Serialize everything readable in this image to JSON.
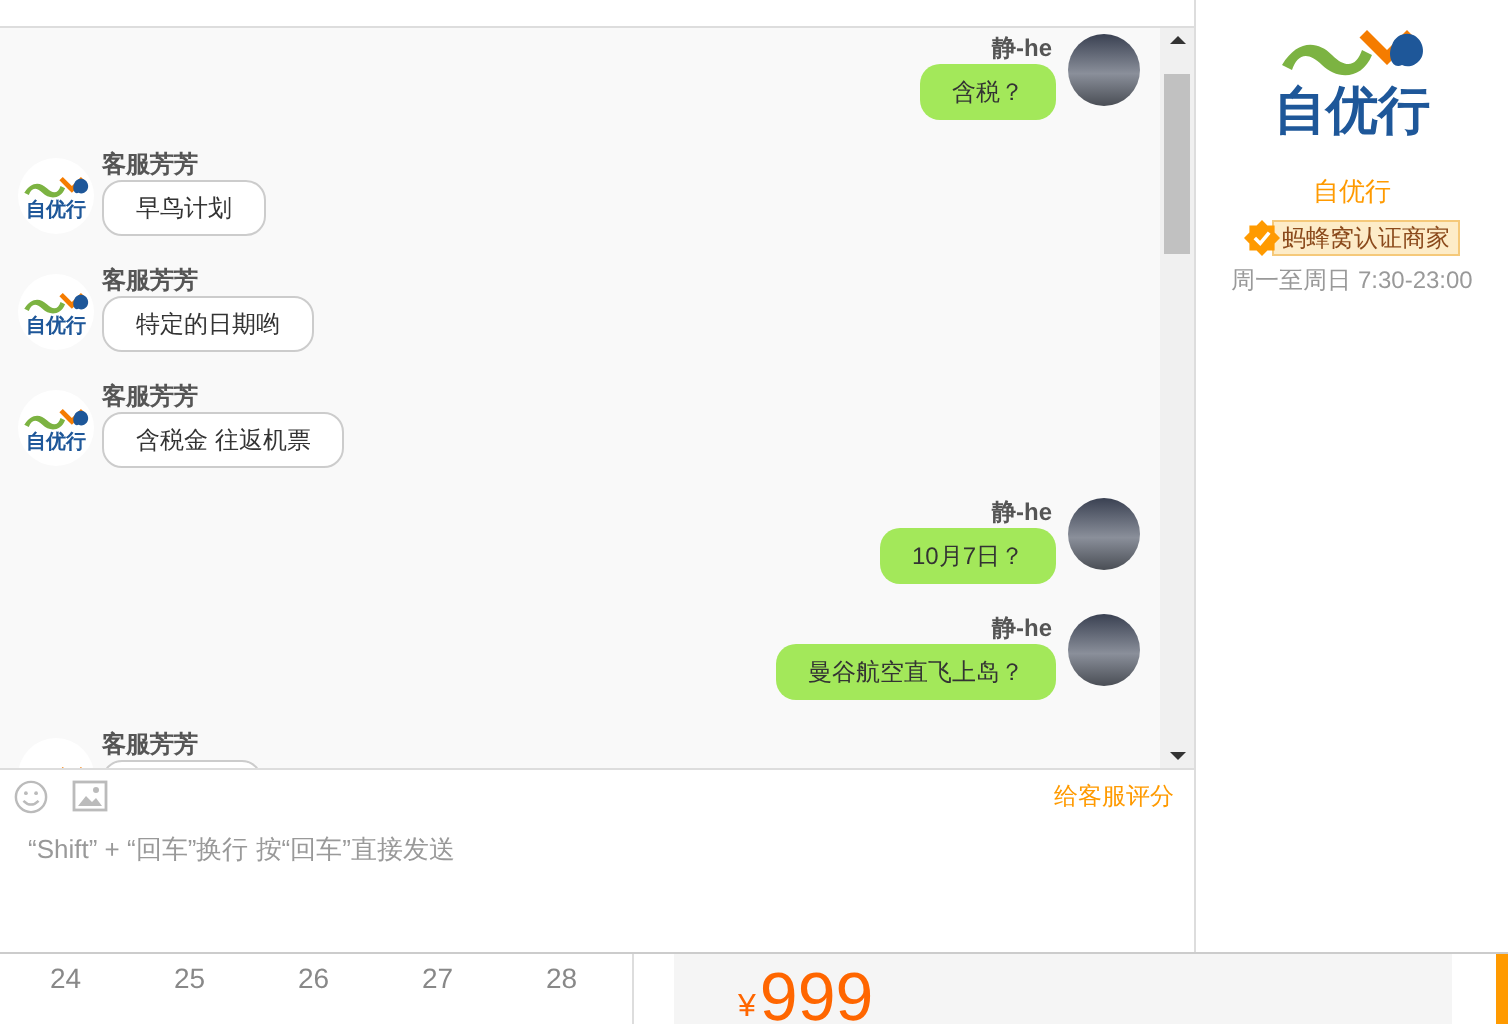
{
  "messages": [
    {
      "kind": "user",
      "name": "静-he",
      "text": "含税？"
    },
    {
      "kind": "agent",
      "avatar_text": "自优行",
      "name": "客服芳芳",
      "text": "早鸟计划"
    },
    {
      "kind": "agent",
      "avatar_text": "自优行",
      "name": "客服芳芳",
      "text": "特定的日期哟"
    },
    {
      "kind": "agent",
      "avatar_text": "自优行",
      "name": "客服芳芳",
      "text": "含税金 往返机票"
    },
    {
      "kind": "user",
      "name": "静-he",
      "text": "10月7日？"
    },
    {
      "kind": "user",
      "name": "静-he",
      "text": "曼谷航空直飞上岛？"
    },
    {
      "kind": "agent",
      "name": "客服芳芳"
    }
  ],
  "composer": {
    "rate_link": "给客服评分",
    "placeholder": "“Shift” + “回车”换行 按“回车”直接发送"
  },
  "calendar_days": [
    "24",
    "25",
    "26",
    "27",
    "28"
  ],
  "price": {
    "currency": "¥",
    "amount": "999"
  },
  "merchant": {
    "logo_text": "自优行",
    "name": "自优行",
    "badge": "蚂蜂窝认证商家",
    "hours": "周一至周日 7:30-23:00"
  }
}
